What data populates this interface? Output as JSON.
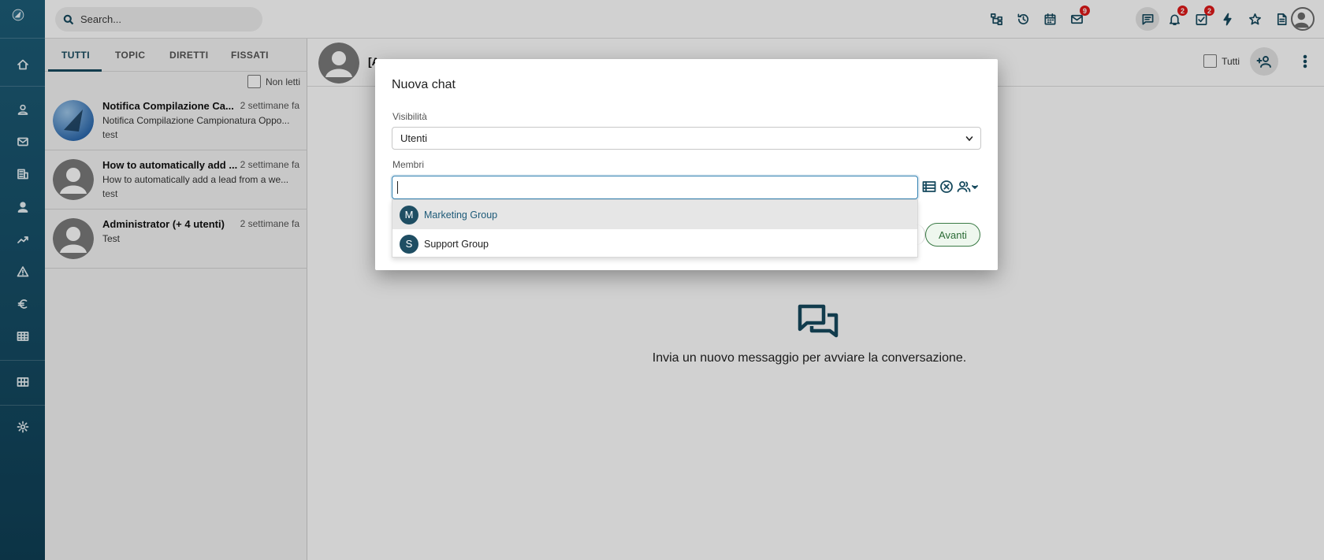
{
  "topbar": {
    "search_placeholder": "Search...",
    "icons": [
      "org-chart-icon",
      "history-icon",
      "calendar-icon",
      "mail-icon",
      "chat-icon",
      "bell-icon",
      "tasks-icon",
      "bolt-icon",
      "star-icon",
      "document-icon",
      "timer-icon"
    ],
    "badges": {
      "mail": "9",
      "bell": "2",
      "tasks": "2"
    }
  },
  "rail": {
    "items": [
      "home",
      "contacts",
      "mail",
      "companies",
      "person",
      "trending",
      "warning",
      "euro",
      "table",
      "grid",
      "settings"
    ]
  },
  "chatlist": {
    "tabs": [
      "TUTTI",
      "TOPIC",
      "DIRETTI",
      "FISSATI"
    ],
    "unread_label": "Non letti",
    "items": [
      {
        "name": "Notifica Compilazione Ca...",
        "time": "2 settimane fa",
        "preview": "Notifica Compilazione Campionatura Oppo...",
        "sub": "test"
      },
      {
        "name": "How to automatically add ...",
        "time": "2 settimane fa",
        "preview": "How to automatically add a lead from a we...",
        "sub": "test"
      },
      {
        "name": "Administrator (+ 4 utenti)",
        "time": "2 settimane fa",
        "preview": "Test",
        "sub": ""
      }
    ]
  },
  "conversation": {
    "title": "[A",
    "tutti_label": "Tutti",
    "empty_message": "Invia un nuovo messaggio per avviare la conversazione."
  },
  "modal": {
    "title": "Nuova chat",
    "visibility_label": "Visibilità",
    "visibility_value": "Utenti",
    "members_label": "Membri",
    "members_value": "",
    "next_button": "Avanti",
    "suggestions": [
      {
        "initial": "M",
        "label": "Marketing Group"
      },
      {
        "initial": "S",
        "label": "Support Group"
      }
    ]
  },
  "colors": {
    "brand": "#174a5e",
    "badge": "#e01919",
    "accent_button": "#2b6b36"
  }
}
